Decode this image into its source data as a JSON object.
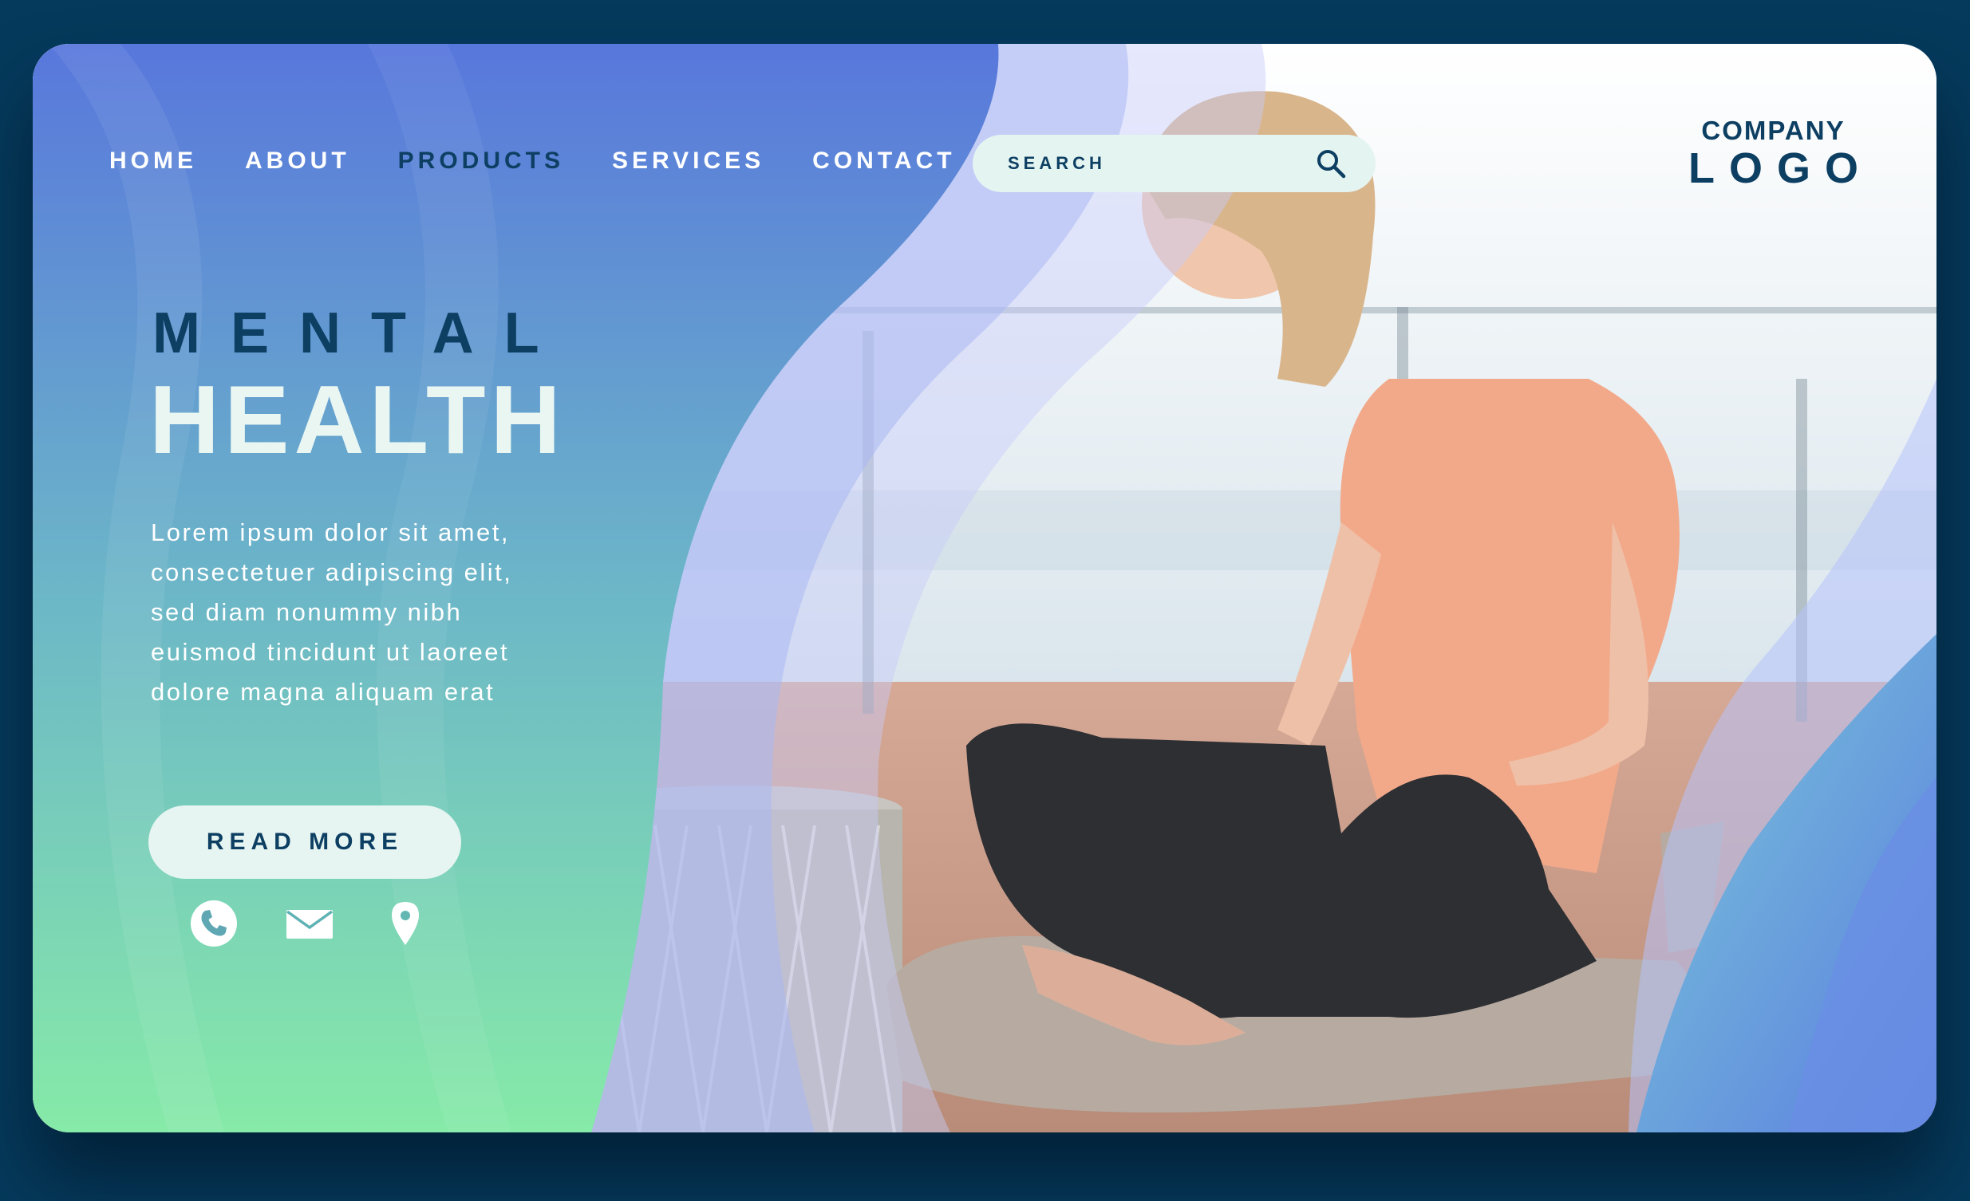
{
  "nav": {
    "items": [
      {
        "label": "HOME"
      },
      {
        "label": "ABOUT"
      },
      {
        "label": "PRODUCTS"
      },
      {
        "label": "SERVICES"
      },
      {
        "label": "CONTACT"
      }
    ],
    "active": "PRODUCTS"
  },
  "search": {
    "placeholder": "SEARCH",
    "icon": "search-icon"
  },
  "logo": {
    "line1": "COMPANY",
    "line2": "LOGO"
  },
  "hero": {
    "title_line1": "MENTAL",
    "title_line2": "HEALTH",
    "body": "Lorem ipsum dolor sit amet, consectetuer adipiscing elit, sed diam nonummy nibh euismod tincidunt ut laoreet dolore magna aliquam erat",
    "cta_label": "READ MORE"
  },
  "contact_icons": [
    "phone-icon",
    "mail-icon",
    "location-pin-icon"
  ],
  "colors": {
    "page_background": "#053a5c",
    "dark_text": "#0d3f63",
    "light_text": "#ffffff",
    "gradient_top": "#5877dc",
    "gradient_bottom": "#86eaa8",
    "pill_background": "#e4f4f1"
  }
}
